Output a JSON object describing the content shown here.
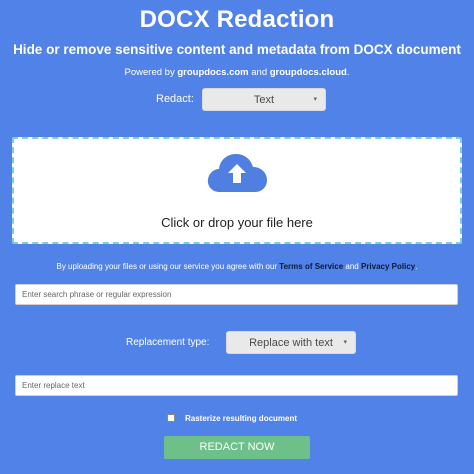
{
  "header": {
    "title": "DOCX Redaction",
    "subtitle": "Hide or remove sensitive content and metadata from DOCX document",
    "powered_prefix": "Powered by ",
    "powered_site1": "groupdocs.com",
    "powered_and": " and ",
    "powered_site2": "groupdocs.cloud",
    "powered_suffix": "."
  },
  "redact": {
    "label": "Redact:",
    "selected": "Text"
  },
  "dropzone": {
    "text": "Click or drop your file here",
    "icon": "cloud-upload-icon"
  },
  "agreement": {
    "prefix": "By uploading your files or using our service you agree with our ",
    "terms": "Terms of Service",
    "and": " and ",
    "privacy": "Privacy Policy",
    "suffix": "."
  },
  "search": {
    "placeholder": "Enter search phrase or regular expression"
  },
  "replacement": {
    "label": "Replacement type:",
    "selected": "Replace with text"
  },
  "replace_text": {
    "placeholder": "Enter replace text"
  },
  "rasterize": {
    "label": "Rasterize resulting document",
    "checked": false
  },
  "action": {
    "button_label": "REDACT NOW"
  },
  "colors": {
    "background": "#5182e8",
    "upload_icon": "#4f7fe0",
    "dropzone_border": "#7ecfdd",
    "button": "#6ec08a"
  }
}
